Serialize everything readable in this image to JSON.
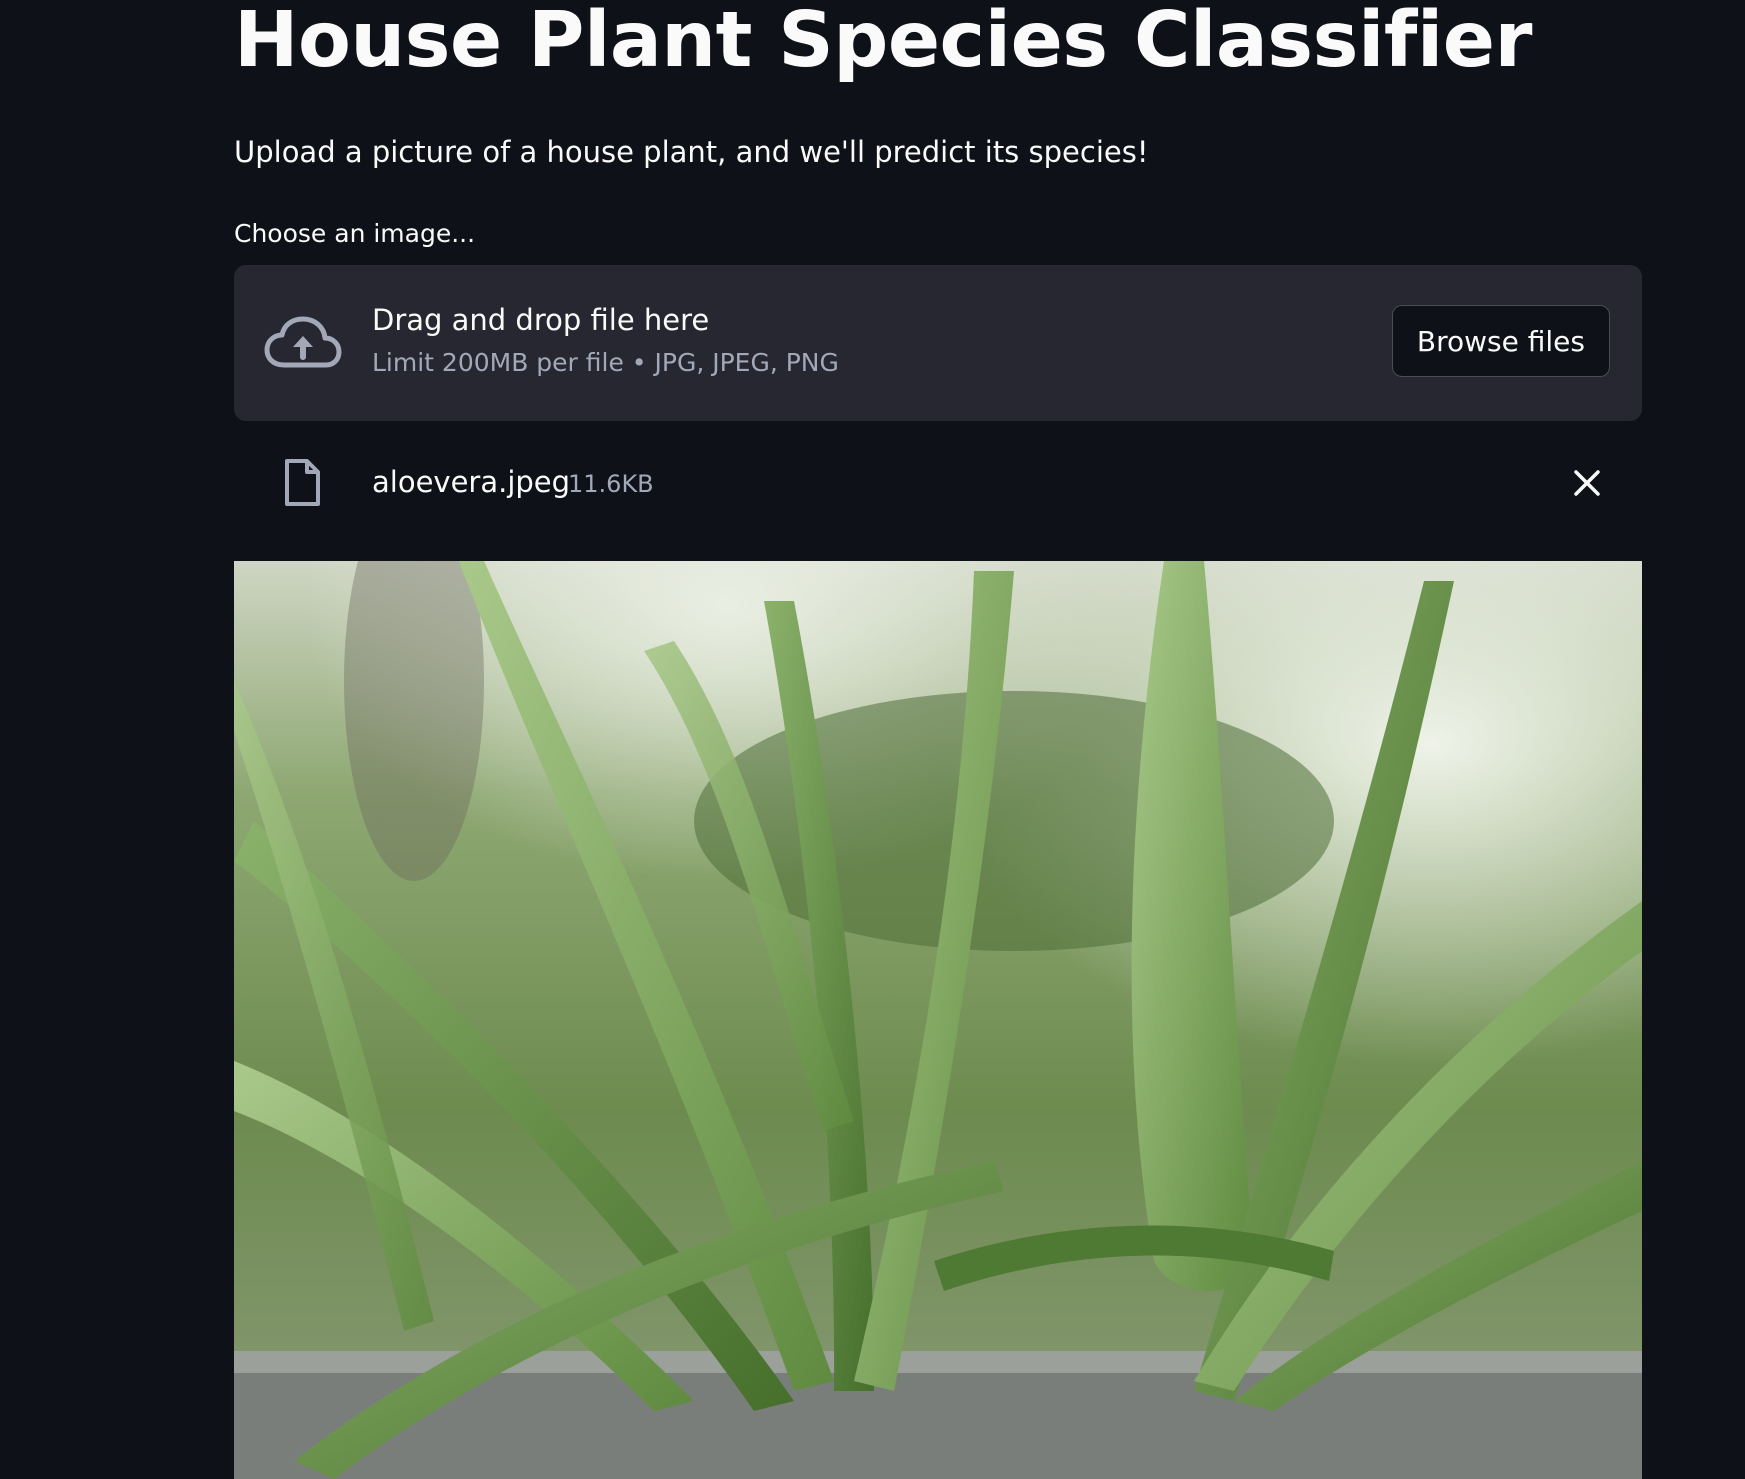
{
  "page": {
    "title": "House Plant Species Classifier",
    "subtitle": "Upload a picture of a house plant, and we'll predict its species!"
  },
  "uploader": {
    "label": "Choose an image...",
    "dropzone_title": "Drag and drop file here",
    "dropzone_limit": "Limit 200MB per file • JPG, JPEG, PNG",
    "browse_label": "Browse files",
    "icon": "cloud-upload-icon"
  },
  "uploaded_file": {
    "name": "aloevera.jpeg",
    "size": "11.6KB",
    "icon": "file-icon",
    "remove_icon": "close-icon"
  },
  "colors": {
    "background": "#0e1117",
    "dropzone": "#262730",
    "text": "#fafafa",
    "muted_text": "#a3a8b8"
  }
}
